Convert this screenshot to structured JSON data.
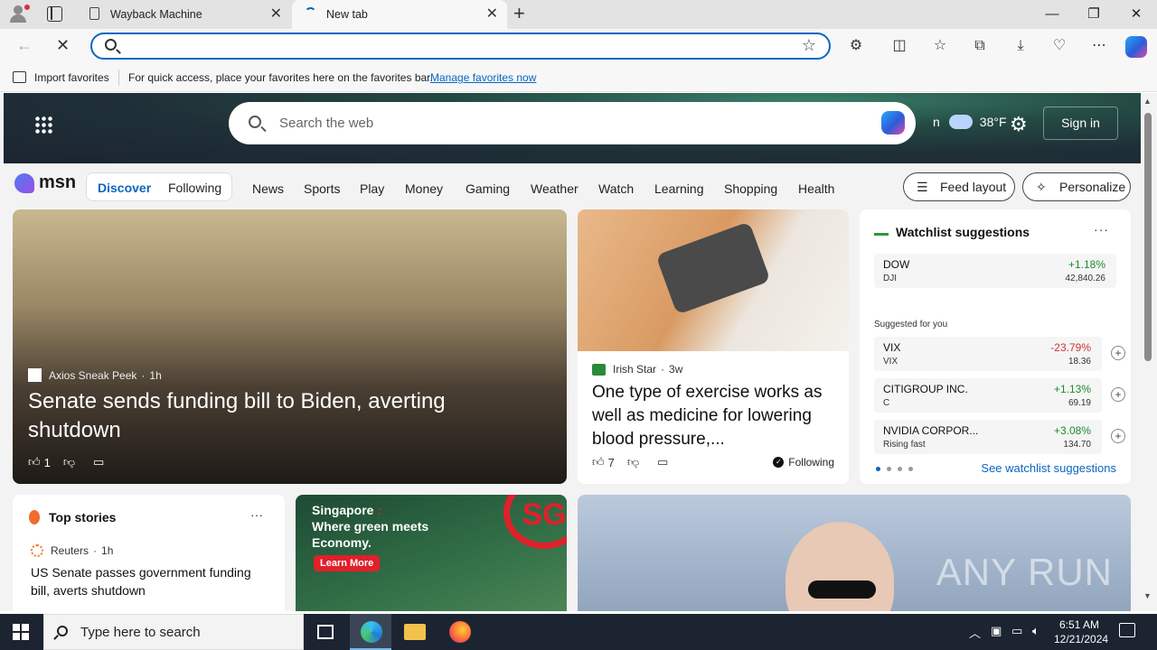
{
  "browser": {
    "tabs": [
      {
        "label": "Wayback Machine",
        "icon": "document-icon"
      },
      {
        "label": "New tab",
        "icon": "loading-spinner-icon"
      }
    ],
    "address_bar": {
      "value": "",
      "placeholder": ""
    },
    "favorites_bar": {
      "import_label": "Import favorites",
      "message": "For quick access, place your favorites here on the favorites bar.",
      "manage_link": "Manage favorites now"
    }
  },
  "msn": {
    "search_placeholder": "Search the web",
    "weather_city": "n",
    "weather_temp": "38°F",
    "sign_in": "Sign in",
    "logo": "msn",
    "pills": {
      "discover": "Discover",
      "following": "Following"
    },
    "nav_links": [
      "News",
      "Sports",
      "Play",
      "Money",
      "Gaming",
      "Weather",
      "Watch",
      "Learning",
      "Shopping",
      "Health"
    ],
    "feed_layout": "Feed layout",
    "personalize": "Personalize",
    "main_story": {
      "source": "Axios Sneak Peek",
      "age": "1h",
      "title": "Senate sends funding bill to Biden, averting shutdown",
      "likes": "1"
    },
    "mid_story": {
      "source": "Irish Star",
      "age": "3w",
      "title": "One type of exercise works as well as medicine for lowering blood pressure,...",
      "likes": "7",
      "following": "Following"
    },
    "watchlist": {
      "title": "Watchlist suggestions",
      "top": {
        "name": "DOW",
        "symbol": "DJI",
        "change": "+1.18%",
        "value": "42,840.26"
      },
      "suggested_label": "Suggested for you",
      "items": [
        {
          "name": "VIX",
          "symbol": "VIX",
          "change": "-23.79%",
          "value": "18.36"
        },
        {
          "name": "CITIGROUP INC.",
          "symbol": "C",
          "change": "+1.13%",
          "value": "69.19"
        },
        {
          "name": "NVIDIA CORPOR...",
          "symbol": "Rising fast",
          "change": "+3.08%",
          "value": "134.70"
        }
      ],
      "see_link": "See watchlist suggestions"
    },
    "top_stories": {
      "title": "Top stories",
      "source": "Reuters",
      "age": "1h",
      "headline": "US Senate passes government funding bill, averts shutdown"
    },
    "ad": {
      "line1": "Singapore",
      "line1_suffix": ":",
      "line2": "Where green meets",
      "line3": "Economy.",
      "cta": "Learn More",
      "brand": "SG"
    },
    "watermark": "ANY RUN"
  },
  "taskbar": {
    "search_placeholder": "Type here to search",
    "time": "6:51 AM",
    "date": "12/21/2024"
  }
}
